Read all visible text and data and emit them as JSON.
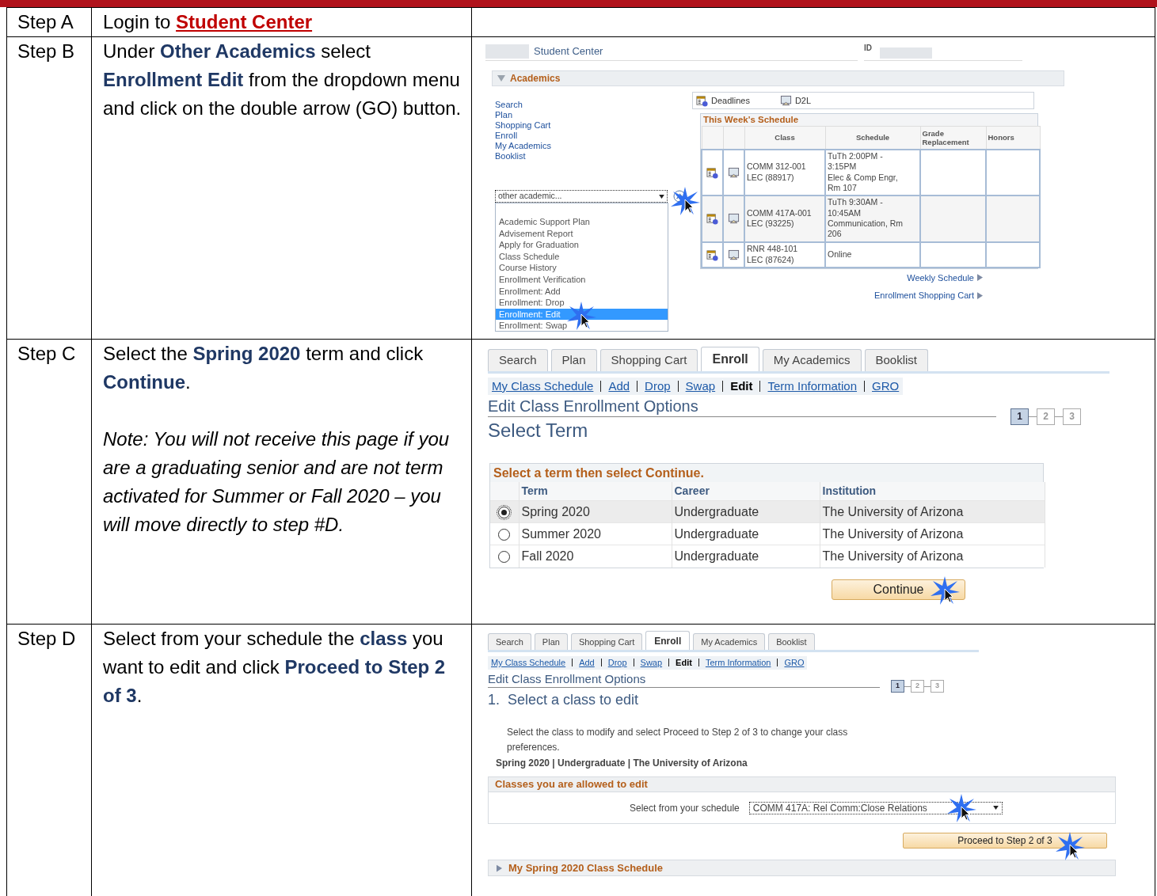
{
  "steps": [
    {
      "label": "Step A",
      "instruction": "Login to",
      "link": "Student Center"
    },
    {
      "label": "Step B",
      "instruction": "Under **Other Academics** select **Enrollment Edit** from the dropdown menu and click on the double arrow (GO) button.",
      "screen": {
        "kind": "student_center",
        "title": "Student Center",
        "id_label": "ID",
        "section": "Academics",
        "links": [
          "Search",
          "Plan",
          "Shopping Cart",
          "Enroll",
          "My Academics",
          "Booklist"
        ],
        "toolbar": [
          "Deadlines",
          "D2L"
        ],
        "schedule_title": "This Week's Schedule",
        "columns": [
          "Class",
          "Schedule",
          "Grade Replacement",
          "Honors"
        ],
        "rows": [
          {
            "class": [
              "COMM 312-001",
              "LEC (88917)"
            ],
            "schedule": [
              "TuTh 2:00PM -",
              "3:15PM",
              "Elec & Comp Engr,",
              "Rm 107"
            ]
          },
          {
            "class": [
              "COMM 417A-001",
              "LEC (93225)"
            ],
            "schedule": [
              "TuTh 9:30AM -",
              "10:45AM",
              "Communication, Rm",
              "206"
            ]
          },
          {
            "class": [
              "RNR 448-101",
              "LEC (87624)"
            ],
            "schedule": [
              "Online"
            ]
          }
        ],
        "footer_links": [
          "Weekly Schedule",
          "Enrollment Shopping Cart"
        ],
        "dropdown": {
          "value": "other academic...",
          "options": [
            {
              "label": "Academic Support Plan",
              "selected": false
            },
            {
              "label": "Advisement Report",
              "selected": false
            },
            {
              "label": "Apply for Graduation",
              "selected": false
            },
            {
              "label": "Class Schedule",
              "selected": false
            },
            {
              "label": "Course History",
              "selected": false
            },
            {
              "label": "Enrollment Verification",
              "selected": false
            },
            {
              "label": "Enrollment: Add",
              "selected": false
            },
            {
              "label": "Enrollment: Drop",
              "selected": false
            },
            {
              "label": "Enrollment: Edit",
              "selected": true
            },
            {
              "label": "Enrollment: Swap",
              "selected": false
            }
          ]
        }
      }
    },
    {
      "label": "Step C",
      "instruction": "Select the **Spring 2020** term and click **Continue**.",
      "note": "Note: You will not receive this page if you are a graduating senior and are not term activated for Summer or Fall 2020 – you will move directly to step #D.",
      "screen": {
        "kind": "select_term",
        "tabs": [
          {
            "label": "Search",
            "selected": false
          },
          {
            "label": "Plan",
            "selected": false
          },
          {
            "label": "Shopping Cart",
            "selected": false
          },
          {
            "label": "Enroll",
            "selected": true
          },
          {
            "label": "My Academics",
            "selected": false
          },
          {
            "label": "Booklist",
            "selected": false
          }
        ],
        "subnav": [
          {
            "label": "My Class Schedule",
            "selected": false
          },
          {
            "label": "Add",
            "selected": false
          },
          {
            "label": "Drop",
            "selected": false
          },
          {
            "label": "Swap",
            "selected": false
          },
          {
            "label": "Edit",
            "selected": true
          },
          {
            "label": "Term Information",
            "selected": false
          },
          {
            "label": "GRO",
            "selected": false
          }
        ],
        "page_title": "Edit Class Enrollment Options",
        "progress": [
          {
            "label": "1",
            "selected": true
          },
          {
            "label": "2",
            "selected": false
          },
          {
            "label": "3",
            "selected": false
          }
        ],
        "heading": "Select Term",
        "grid_title": "Select a term then select Continue.",
        "columns": [
          "Term",
          "Career",
          "Institution"
        ],
        "rows": [
          {
            "term": "Spring 2020",
            "career": "Undergraduate",
            "institution": "The University of Arizona",
            "selected": true
          },
          {
            "term": "Summer 2020",
            "career": "Undergraduate",
            "institution": "The University of Arizona",
            "selected": false
          },
          {
            "term": "Fall 2020",
            "career": "Undergraduate",
            "institution": "The University of Arizona",
            "selected": false
          }
        ],
        "button": "Continue"
      }
    },
    {
      "label": "Step D",
      "instruction": "Select from your schedule the **class** you want to edit and click **Proceed to Step 2 of 3**.",
      "screen": {
        "kind": "select_class",
        "tabs": [
          {
            "label": "Search",
            "selected": false
          },
          {
            "label": "Plan",
            "selected": false
          },
          {
            "label": "Shopping Cart",
            "selected": false
          },
          {
            "label": "Enroll",
            "selected": true
          },
          {
            "label": "My Academics",
            "selected": false
          },
          {
            "label": "Booklist",
            "selected": false
          }
        ],
        "subnav": [
          {
            "label": "My Class Schedule",
            "selected": false
          },
          {
            "label": "Add",
            "selected": false
          },
          {
            "label": "Drop",
            "selected": false
          },
          {
            "label": "Swap",
            "selected": false
          },
          {
            "label": "Edit",
            "selected": true
          },
          {
            "label": "Term Information",
            "selected": false
          },
          {
            "label": "GRO",
            "selected": false
          }
        ],
        "page_title": "Edit Class Enrollment Options",
        "progress": [
          {
            "label": "1",
            "selected": true
          },
          {
            "label": "2",
            "selected": false
          },
          {
            "label": "3",
            "selected": false
          }
        ],
        "heading": "1.  Select a class to edit",
        "description": "Select the class to modify and select Proceed to Step 2 of 3 to change your class preferences.",
        "term_summary": "Spring 2020 | Undergraduate | The University of Arizona",
        "section": "Classes you are allowed to edit",
        "field_label": "Select from your schedule",
        "dropdown_value": "COMM 417A: Rel Comm:Close Relations",
        "button": "Proceed to Step 2 of 3",
        "collapsed_section": {
          "label": "My Spring 2020 Class Schedule",
          "expanded": false
        }
      }
    }
  ]
}
